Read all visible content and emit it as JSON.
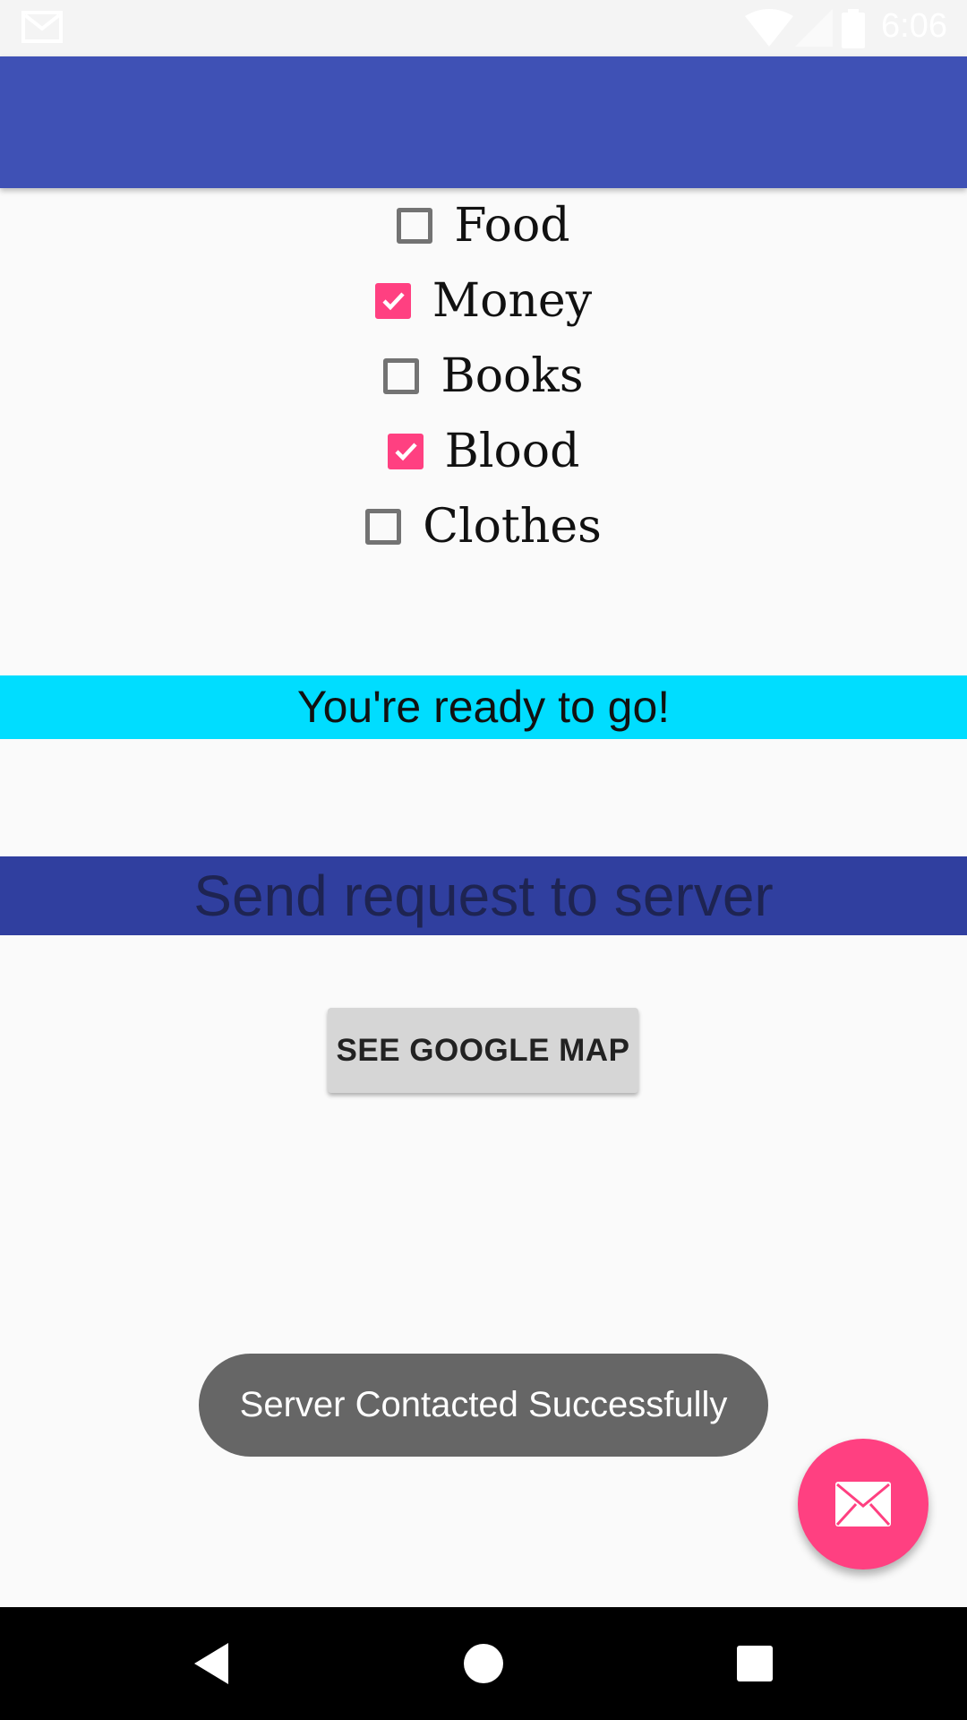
{
  "status_bar": {
    "time": "6:06",
    "icons": [
      "mail-icon",
      "wifi-icon",
      "signal-icon",
      "battery-icon"
    ]
  },
  "app_bar": {
    "color": "#3f51b5"
  },
  "options": [
    {
      "label": "Food",
      "checked": false
    },
    {
      "label": "Money",
      "checked": true
    },
    {
      "label": "Books",
      "checked": false
    },
    {
      "label": "Blood",
      "checked": true
    },
    {
      "label": "Clothes",
      "checked": false
    }
  ],
  "ready_banner": {
    "text": "You're ready to go!",
    "color": "#00ddff"
  },
  "send_request": {
    "text": "Send request to server",
    "color": "#303f9f"
  },
  "map_button": {
    "label": "SEE GOOGLE MAP"
  },
  "toast": {
    "text": "Server Contacted Successfully"
  },
  "fab": {
    "icon": "email-icon",
    "color": "#ff4081"
  },
  "nav_bar": {
    "buttons": [
      "back-icon",
      "home-icon",
      "recents-icon"
    ]
  },
  "colors": {
    "accent": "#ff4081",
    "primary": "#3f51b5"
  }
}
